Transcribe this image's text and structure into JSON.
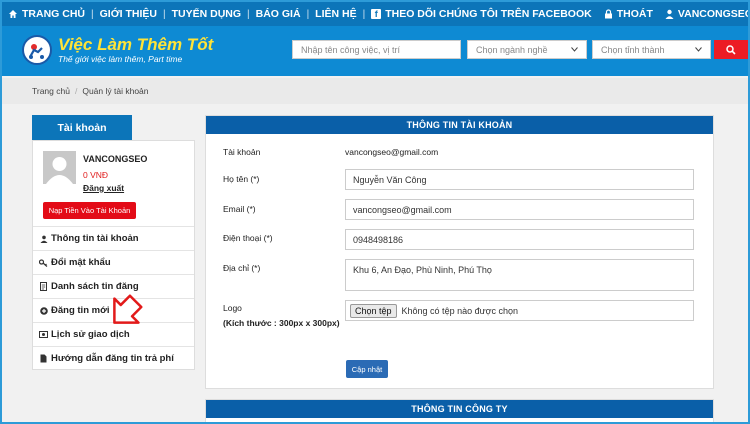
{
  "topnav": {
    "items": [
      "TRANG CHỦ",
      "GIỚI THIỆU",
      "TUYỂN DỤNG",
      "BÁO GIÁ",
      "LIÊN HỆ"
    ],
    "facebook": "THEO DÕI CHÚNG TÔI TRÊN FACEBOOK",
    "logout": "THOÁT",
    "username": "VANCONGSEO"
  },
  "header": {
    "logo_title": "Việc Làm Thêm Tốt",
    "logo_subtitle": "Thế giới việc làm thêm, Part time",
    "search_placeholder": "Nhập tên công việc, vị trí",
    "category_select": "Chọn ngành nghề",
    "province_select": "Chọn tỉnh thành"
  },
  "breadcrumb": {
    "home": "Trang chủ",
    "separator": "/",
    "current": "Quản lý tài khoản"
  },
  "sidebar": {
    "tab": "Tài khoản",
    "name": "VANCONGSEO",
    "balance": "0 VNĐ",
    "logout": "Đăng xuất",
    "topup": "Nạp Tiền Vào Tài Khoản",
    "menu": [
      {
        "label": "Thông tin tài khoản",
        "icon": "user-icon"
      },
      {
        "label": "Đổi mật khẩu",
        "icon": "key-icon"
      },
      {
        "label": "Danh sách tin đăng",
        "icon": "document-icon"
      },
      {
        "label": "Đăng tin mới",
        "icon": "plus-circle-icon"
      },
      {
        "label": "Lịch sử giao dịch",
        "icon": "money-icon"
      },
      {
        "label": "Hướng dẫn đăng tin trả phí",
        "icon": "file-icon"
      }
    ]
  },
  "account": {
    "heading": "THÔNG TIN TÀI KHOẢN",
    "account_label": "Tài khoản",
    "account_value": "vancongseo@gmail.com",
    "name_label": "Họ tên (*)",
    "name_value": "Nguyễn Văn Công",
    "email_label": "Email (*)",
    "email_value": "vancongseo@gmail.com",
    "phone_label": "Điện thoại (*)",
    "phone_value": "0948498186",
    "address_label": "Địa chỉ (*)",
    "address_value": "Khu 6, An Đạo, Phù Ninh, Phú Thọ",
    "logo_label": "Logo",
    "logo_size": "(Kích thước : 300px x 300px)",
    "file_button": "Chọn tệp",
    "file_status": "Không có tệp nào được chọn",
    "update_button": "Cập nhật"
  },
  "company": {
    "heading": "THÔNG TIN CÔNG TY"
  },
  "colors": {
    "nav": "#0c75b9",
    "header": "#0e8ad3",
    "accent_red": "#e30b17",
    "arrow_red": "#e21a1a"
  }
}
